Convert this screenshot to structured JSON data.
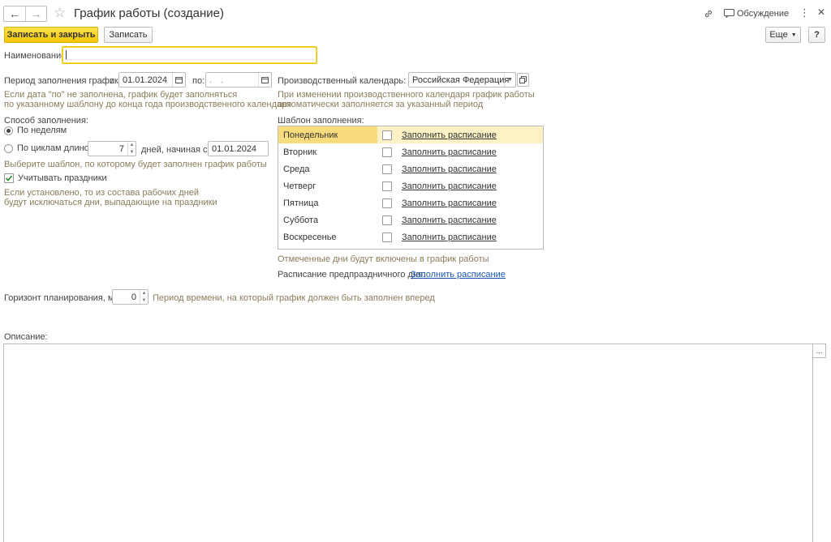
{
  "window": {
    "title": "График работы (создание)",
    "discussion_label": "Обсуждение"
  },
  "toolbar": {
    "save_close_label": "Записать и закрыть",
    "save_label": "Записать",
    "more_label": "Еще",
    "help_label": "?"
  },
  "name_field": {
    "label": "Наименование:",
    "value": ""
  },
  "period": {
    "label": "Период заполнения графика",
    "from_label": "с:",
    "from_value": "01.01.2024",
    "to_label": "по:",
    "to_value": ". .",
    "hint_line1": "Если дата \"по\" не заполнена, график будет заполняться",
    "hint_line2": "по указанному шаблону до конца года производственного календаря"
  },
  "fill_method": {
    "label": "Способ заполнения:",
    "by_weeks_label": "По неделям",
    "by_weeks_selected": true,
    "by_cycles_label": "По циклам длиной",
    "by_cycles_selected": false,
    "cycle_length": "7",
    "days_label": "дней,",
    "starting_label": "начиная с:",
    "starting_value": "01.01.2024",
    "hint": "Выберите шаблон, по которому будет заполнен график работы"
  },
  "holidays": {
    "label": "Учитывать праздники",
    "checked": true,
    "hint_line1": "Если установлено, то из состава рабочих дней",
    "hint_line2": "будут исключаться дни, выпадающие на праздники"
  },
  "production_calendar": {
    "label": "Производственный календарь:",
    "value": "Российская Федерация",
    "hint_line1": "При изменении производственного календаря график работы",
    "hint_line2": "автоматически заполняется за указанный период"
  },
  "template": {
    "label": "Шаблон заполнения:",
    "fill_label": "Заполнить расписание",
    "days": [
      {
        "name": "Понедельник",
        "checked": false
      },
      {
        "name": "Вторник",
        "checked": false
      },
      {
        "name": "Среда",
        "checked": false
      },
      {
        "name": "Четверг",
        "checked": false
      },
      {
        "name": "Пятница",
        "checked": false
      },
      {
        "name": "Суббота",
        "checked": false
      },
      {
        "name": "Воскресенье",
        "checked": false
      }
    ],
    "selected_index": 0,
    "hint": "Отмеченные дни будут включены в график работы",
    "preholiday_label": "Расписание предпраздничного дня:",
    "preholiday_link": "Заполнить расписание"
  },
  "horizon": {
    "label": "Горизонт планирования, мес.:",
    "value": "0",
    "hint": "Период времени, на который график должен быть заполнен вперед"
  },
  "description": {
    "label": "Описание:",
    "value": "",
    "button_label": "..."
  }
}
